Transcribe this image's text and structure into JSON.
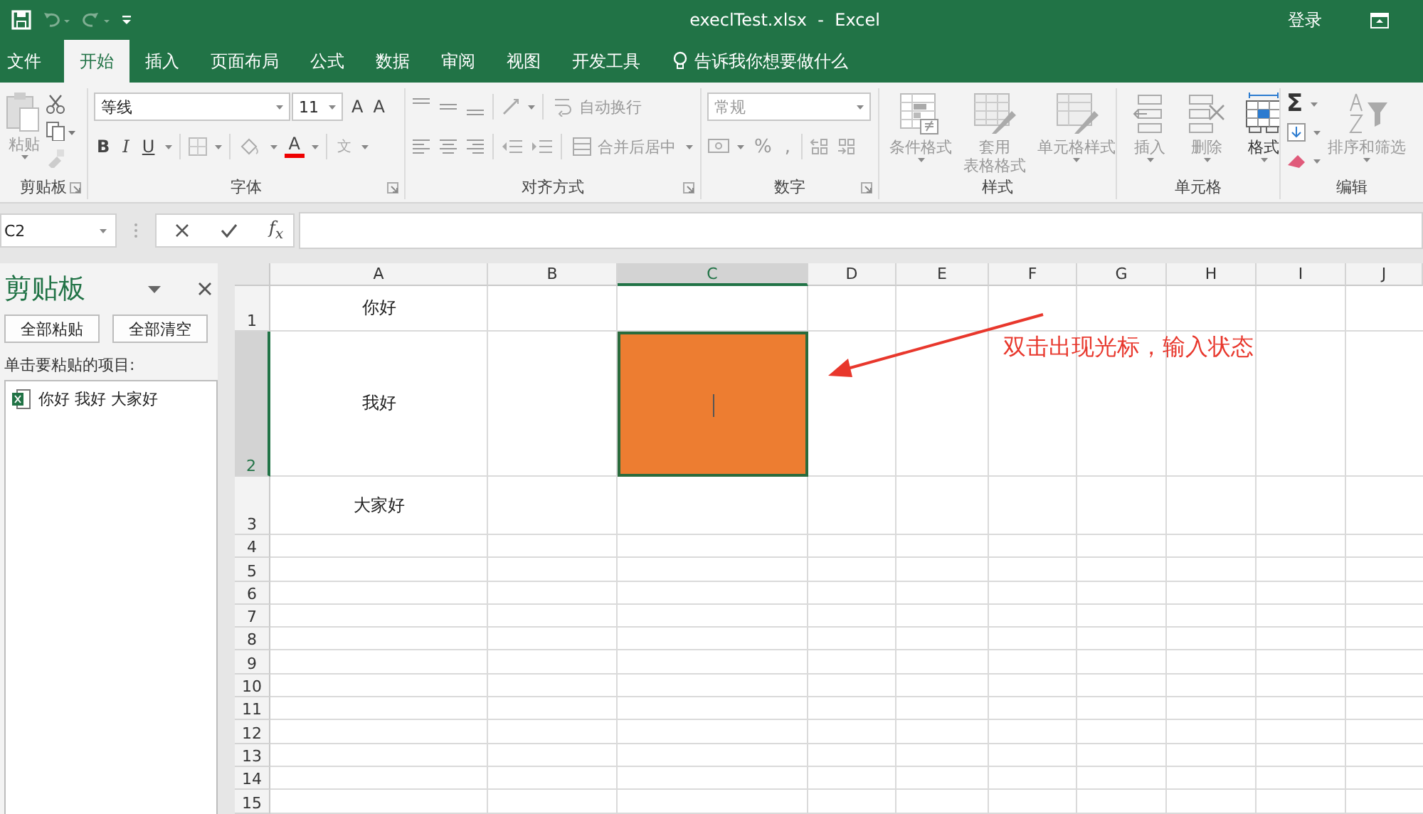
{
  "title_bar": {
    "title": "execlTest.xlsx  -  Excel",
    "sign_in": "登录"
  },
  "tabs": [
    {
      "label": "文件",
      "selected": false
    },
    {
      "label": "开始",
      "selected": true
    },
    {
      "label": "插入",
      "selected": false
    },
    {
      "label": "页面布局",
      "selected": false
    },
    {
      "label": "公式",
      "selected": false
    },
    {
      "label": "数据",
      "selected": false
    },
    {
      "label": "审阅",
      "selected": false
    },
    {
      "label": "视图",
      "selected": false
    },
    {
      "label": "开发工具",
      "selected": false
    }
  ],
  "tell_me": "告诉我你想要做什么",
  "ribbon": {
    "groups": [
      {
        "label": "剪贴板",
        "paste": "粘贴"
      },
      {
        "label": "字体",
        "font_name": "等线",
        "font_size": "11",
        "grow": "A",
        "shrink": "A",
        "bold": "B",
        "italic": "I",
        "underline": "U",
        "font_color": "A",
        "phonetic": "文"
      },
      {
        "label": "对齐方式",
        "wrap_text": "自动换行",
        "merge": "合并后居中"
      },
      {
        "label": "数字",
        "format": "常规",
        "percent": "%",
        "comma": ","
      },
      {
        "label": "样式",
        "buttons": [
          {
            "label": [
              "条件格式"
            ],
            "disabled": true
          },
          {
            "label": [
              "套用",
              "表格格式"
            ],
            "disabled": true
          },
          {
            "label": [
              "单元格样式"
            ],
            "disabled": true
          }
        ]
      },
      {
        "label": "单元格",
        "buttons": [
          {
            "label": [
              "插入"
            ],
            "disabled": true
          },
          {
            "label": [
              "删除"
            ],
            "disabled": true
          },
          {
            "label": [
              "格式"
            ],
            "disabled": false
          }
        ]
      },
      {
        "label": "编辑",
        "sum": "Σ",
        "buttons": [
          {
            "label": [
              "排序和筛选"
            ],
            "disabled": true
          }
        ]
      }
    ]
  },
  "formula_bar": {
    "name_box": "C2",
    "fx": "f$_{x}$"
  },
  "clipboard_pane": {
    "title": "剪贴板",
    "paste_all": "全部粘贴",
    "clear_all": "全部清空",
    "hint": "单击要粘贴的项目:",
    "items": [
      "你好 我好 大家好"
    ]
  },
  "grid": {
    "editing": true,
    "columns": [
      {
        "label": "A",
        "selected": false
      },
      {
        "label": "B",
        "selected": false
      },
      {
        "label": "C",
        "selected": true
      },
      {
        "label": "D",
        "selected": false
      },
      {
        "label": "E",
        "selected": false
      },
      {
        "label": "F",
        "selected": false
      },
      {
        "label": "G",
        "selected": false
      },
      {
        "label": "H",
        "selected": false
      },
      {
        "label": "I",
        "selected": false
      },
      {
        "label": "J",
        "selected": false
      }
    ],
    "rows": [
      {
        "header": "1",
        "selected": false,
        "cells": [
          "你好"
        ]
      },
      {
        "header": "2",
        "selected": true,
        "cells": [
          "我好"
        ]
      },
      {
        "header": "3",
        "selected": false,
        "cells": [
          "大家好"
        ]
      },
      {
        "header": "4",
        "selected": false
      },
      {
        "header": "5",
        "selected": false
      },
      {
        "header": "6",
        "selected": false
      },
      {
        "header": "7",
        "selected": false
      },
      {
        "header": "8",
        "selected": false
      },
      {
        "header": "9",
        "selected": false
      },
      {
        "header": "10",
        "selected": false
      },
      {
        "header": "11",
        "selected": false
      },
      {
        "header": "12",
        "selected": false
      },
      {
        "header": "13",
        "selected": false
      },
      {
        "header": "14",
        "selected": false
      },
      {
        "header": "15",
        "selected": false
      }
    ]
  },
  "annotation": {
    "text": "双击出现光标，输入状态"
  }
}
